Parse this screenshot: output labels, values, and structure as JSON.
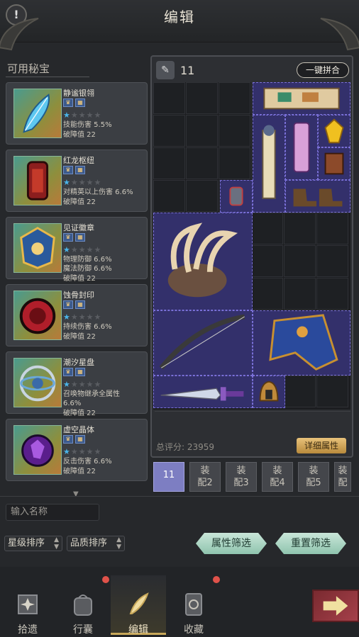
{
  "header": {
    "title": "编辑",
    "alert": "!"
  },
  "left": {
    "title": "可用秘宝"
  },
  "treasures": [
    {
      "name": "静谧银翎",
      "stars": 1,
      "effect": "技能伤害 5.5%",
      "breach": "破障值 22"
    },
    {
      "name": "红龙枢纽",
      "stars": 1,
      "effect": "对精英以上伤害 6.6%",
      "breach": "破障值 22"
    },
    {
      "name": "见证徽章",
      "stars": 1,
      "effect": "物理防御 6.6%\n魔法防御 6.6%",
      "breach": "破障值 22"
    },
    {
      "name": "蚀骨封印",
      "stars": 1,
      "effect": "持续伤害 6.6%",
      "breach": "破障值 22"
    },
    {
      "name": "潮汐星盘",
      "stars": 1,
      "effect": "召唤物继承全属性\n6.6%",
      "breach": "破障值 22"
    },
    {
      "name": "虚空晶体",
      "stars": 1,
      "effect": "反击伤害 6.6%",
      "breach": "破障值 22"
    }
  ],
  "bag": {
    "count": "11",
    "merge_label": "一键拼合",
    "score_label": "总评分: 23959",
    "detail_label": "详细属性"
  },
  "loadouts": [
    {
      "label": "11",
      "active": true
    },
    {
      "label": "装\n配2"
    },
    {
      "label": "装\n配3"
    },
    {
      "label": "装\n配4"
    },
    {
      "label": "装\n配5"
    },
    {
      "label": "装\n配"
    }
  ],
  "filters": {
    "name_placeholder": "输入名称",
    "star_sort": "星级排序",
    "quality_sort": "品质排序",
    "attr_filter": "属性筛选",
    "reset_filter": "重置筛选"
  },
  "nav": [
    {
      "label": "拾遗",
      "icon": "relic-icon"
    },
    {
      "label": "行囊",
      "icon": "backpack-icon"
    },
    {
      "label": "编辑",
      "icon": "edit-quill-icon",
      "active": true
    },
    {
      "label": "收藏",
      "icon": "collection-icon"
    }
  ],
  "colors": {
    "accent_gold": "#c8a85a",
    "star": "#4ab4e8",
    "item_bg": "#33306b",
    "loadout_active": "#7d7ec2"
  }
}
